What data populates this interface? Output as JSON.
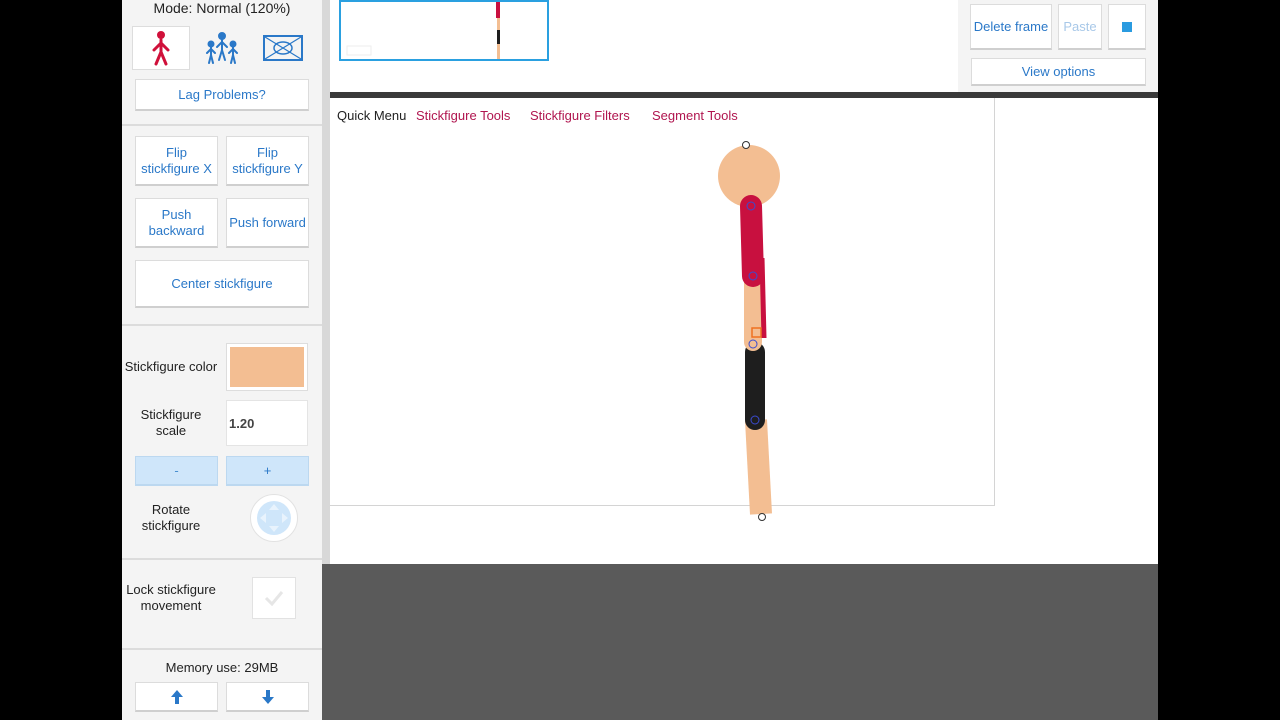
{
  "left_panel": {
    "mode_label": "Mode: Normal (120%)",
    "lag_button": "Lag Problems?",
    "flip_x": "Flip stickfigure X",
    "flip_y": "Flip stickfigure Y",
    "push_backward": "Push backward",
    "push_forward": "Push forward",
    "center": "Center stickfigure",
    "color_label": "Stickfigure color",
    "color_value": "#f3be92",
    "scale_label": "Stickfigure scale",
    "scale_value": "1.20",
    "minus": "-",
    "plus": "+",
    "rotate_label": "Rotate stickfigure",
    "lock_label": "Lock stickfigure movement",
    "memory": "Memory use: 29MB"
  },
  "top_bar": {
    "delete_frame": "Delete frame",
    "paste": "Paste",
    "view_options": "View options"
  },
  "quick_menu": {
    "label": "Quick Menu",
    "items": [
      "Stickfigure Tools",
      "Stickfigure Filters",
      "Segment Tools"
    ]
  },
  "colors": {
    "accent_blue": "#2a78c8",
    "menu_red": "#b0154f",
    "skin": "#f3be92",
    "shirt": "#c8103f",
    "pants": "#1e1e1e"
  }
}
